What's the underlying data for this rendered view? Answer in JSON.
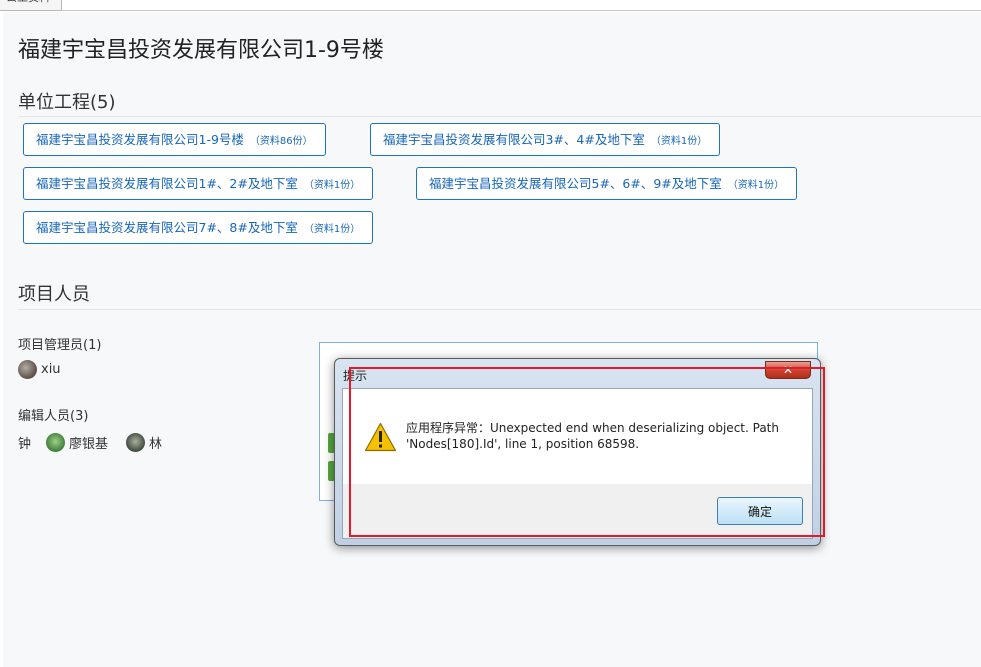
{
  "tab": {
    "label": "公工资料"
  },
  "page": {
    "title": "福建宇宝昌投资发展有限公司1-9号楼"
  },
  "units": {
    "heading": "单位工程(5)",
    "items": [
      {
        "label": "福建宇宝昌投资发展有限公司1-9号楼",
        "count": "（资料86份）"
      },
      {
        "label": "福建宇宝昌投资发展有限公司3#、4#及地下室",
        "count": "（资料1份）"
      },
      {
        "label": "福建宇宝昌投资发展有限公司1#、2#及地下室",
        "count": "（资料1份）"
      },
      {
        "label": "福建宇宝昌投资发展有限公司5#、6#、9#及地下室",
        "count": "（资料1份）"
      },
      {
        "label": "福建宇宝昌投资发展有限公司7#、8#及地下室",
        "count": "（资料1份）"
      }
    ]
  },
  "members": {
    "heading": "项目人员",
    "managers": {
      "title": "项目管理员(1)",
      "people": [
        "xiu"
      ]
    },
    "editors": {
      "title": "编辑人员(3)",
      "people": [
        "钟",
        "廖银基",
        "林"
      ]
    }
  },
  "dialog": {
    "title": "提示",
    "close": "✕",
    "message": "应用程序异常：Unexpected end when deserializing object. Path 'Nodes[180].Id', line 1, position 68598.",
    "ok": "确定"
  },
  "colors": {
    "accent": "#1a73c9",
    "highlight": "#e6192a"
  },
  "icons": {
    "dialog": "warning-icon"
  }
}
